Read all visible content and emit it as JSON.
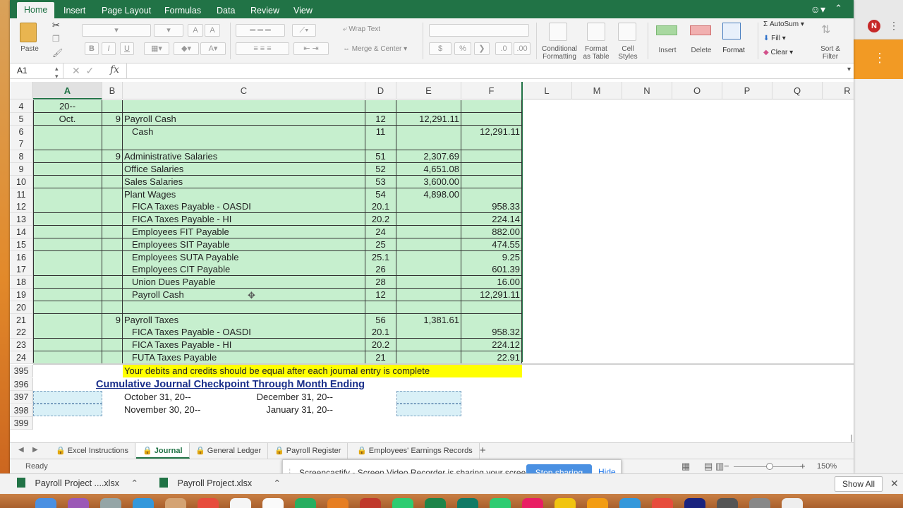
{
  "ribbon_tabs": [
    "Home",
    "Insert",
    "Page Layout",
    "Formulas",
    "Data",
    "Review",
    "View"
  ],
  "ribbon": {
    "paste": "Paste",
    "wrap_text": "Wrap Text",
    "merge_center": "Merge & Center",
    "conditional_formatting_1": "Conditional",
    "conditional_formatting_2": "Formatting",
    "format_table_1": "Format",
    "format_table_2": "as Table",
    "cell_styles_1": "Cell",
    "cell_styles_2": "Styles",
    "insert": "Insert",
    "delete": "Delete",
    "format": "Format",
    "autosum": "AutoSum",
    "fill": "Fill",
    "clear": "Clear",
    "sort_filter_1": "Sort &",
    "sort_filter_2": "Filter",
    "bold": "B",
    "italic": "I",
    "underline": "U",
    "percent": "%",
    "currency": "$"
  },
  "formula_bar": {
    "name_box": "A1",
    "fx": "fx"
  },
  "columns": [
    "A",
    "B",
    "C",
    "D",
    "E",
    "F",
    "L",
    "M",
    "N",
    "O",
    "P",
    "Q",
    "R"
  ],
  "rows": [
    {
      "n": "4",
      "a": "20--",
      "b": "",
      "c": "",
      "indent": 0,
      "d": "",
      "e": "",
      "f": ""
    },
    {
      "n": "5",
      "a": "Oct.",
      "b": "9",
      "c": "Payroll Cash",
      "indent": 0,
      "d": "12",
      "e": "12,291.11",
      "f": ""
    },
    {
      "n": "6",
      "a": "",
      "b": "",
      "c": "Cash",
      "indent": 1,
      "d": "11",
      "e": "",
      "f": "12,291.11"
    },
    {
      "n": "7",
      "a": "",
      "b": "",
      "c": "",
      "indent": 0,
      "d": "",
      "e": "",
      "f": ""
    },
    {
      "n": "8",
      "a": "",
      "b": "9",
      "c": "Administrative Salaries",
      "indent": 0,
      "d": "51",
      "e": "2,307.69",
      "f": ""
    },
    {
      "n": "9",
      "a": "",
      "b": "",
      "c": "Office Salaries",
      "indent": 0,
      "d": "52",
      "e": "4,651.08",
      "f": ""
    },
    {
      "n": "10",
      "a": "",
      "b": "",
      "c": "Sales Salaries",
      "indent": 0,
      "d": "53",
      "e": "3,600.00",
      "f": ""
    },
    {
      "n": "11",
      "a": "",
      "b": "",
      "c": "Plant Wages",
      "indent": 0,
      "d": "54",
      "e": "4,898.00",
      "f": ""
    },
    {
      "n": "12",
      "a": "",
      "b": "",
      "c": "FICA Taxes Payable - OASDI",
      "indent": 1,
      "d": "20.1",
      "e": "",
      "f": "958.33"
    },
    {
      "n": "13",
      "a": "",
      "b": "",
      "c": "FICA Taxes Payable - HI",
      "indent": 1,
      "d": "20.2",
      "e": "",
      "f": "224.14"
    },
    {
      "n": "14",
      "a": "",
      "b": "",
      "c": "Employees FIT Payable",
      "indent": 1,
      "d": "24",
      "e": "",
      "f": "882.00"
    },
    {
      "n": "15",
      "a": "",
      "b": "",
      "c": "Employees SIT Payable",
      "indent": 1,
      "d": "25",
      "e": "",
      "f": "474.55"
    },
    {
      "n": "16",
      "a": "",
      "b": "",
      "c": "Employees SUTA Payable",
      "indent": 1,
      "d": "25.1",
      "e": "",
      "f": "9.25"
    },
    {
      "n": "17",
      "a": "",
      "b": "",
      "c": "Employees CIT Payable",
      "indent": 1,
      "d": "26",
      "e": "",
      "f": "601.39"
    },
    {
      "n": "18",
      "a": "",
      "b": "",
      "c": "Union Dues Payable",
      "indent": 1,
      "d": "28",
      "e": "",
      "f": "16.00"
    },
    {
      "n": "19",
      "a": "",
      "b": "",
      "c": "Payroll Cash",
      "indent": 1,
      "d": "12",
      "e": "",
      "f": "12,291.11"
    },
    {
      "n": "20",
      "a": "",
      "b": "",
      "c": "",
      "indent": 0,
      "d": "",
      "e": "",
      "f": ""
    },
    {
      "n": "21",
      "a": "",
      "b": "9",
      "c": "Payroll Taxes",
      "indent": 0,
      "d": "56",
      "e": "1,381.61",
      "f": ""
    },
    {
      "n": "22",
      "a": "",
      "b": "",
      "c": "FICA Taxes Payable - OASDI",
      "indent": 1,
      "d": "20.1",
      "e": "",
      "f": "958.32"
    },
    {
      "n": "23",
      "a": "",
      "b": "",
      "c": "FICA Taxes Payable - HI",
      "indent": 1,
      "d": "20.2",
      "e": "",
      "f": "224.12"
    },
    {
      "n": "24",
      "a": "",
      "b": "",
      "c": "FUTA Taxes Payable",
      "indent": 1,
      "d": "21",
      "e": "",
      "f": "22.91"
    }
  ],
  "lower_rows": [
    "395",
    "396",
    "397",
    "398",
    "399"
  ],
  "lower": {
    "note": "Your debits and credits should be equal after each journal entry is complete",
    "checkpoint_title": "Cumulative Journal Checkpoint Through Month Ending",
    "oct": "October 31, 20--",
    "dec": "December 31, 20--",
    "nov": "November 30, 20--",
    "jan": "January 31, 20--"
  },
  "sheet_tabs": [
    "Excel Instructions",
    "Journal",
    "General Ledger",
    "Payroll Register",
    "Employees' Earnings Records"
  ],
  "sheet_add": "+",
  "status": {
    "ready": "Ready",
    "zoom": "150%"
  },
  "screencastify": {
    "message": "Screencastify - Screen Video Recorder is sharing your screen.",
    "stop": "Stop sharing",
    "hide": "Hide"
  },
  "downloads": {
    "file1": "Payroll Project ....xlsx",
    "file2": "Payroll Project.xlsx",
    "show_all": "Show All"
  },
  "chrome": {
    "avatar": "N"
  }
}
